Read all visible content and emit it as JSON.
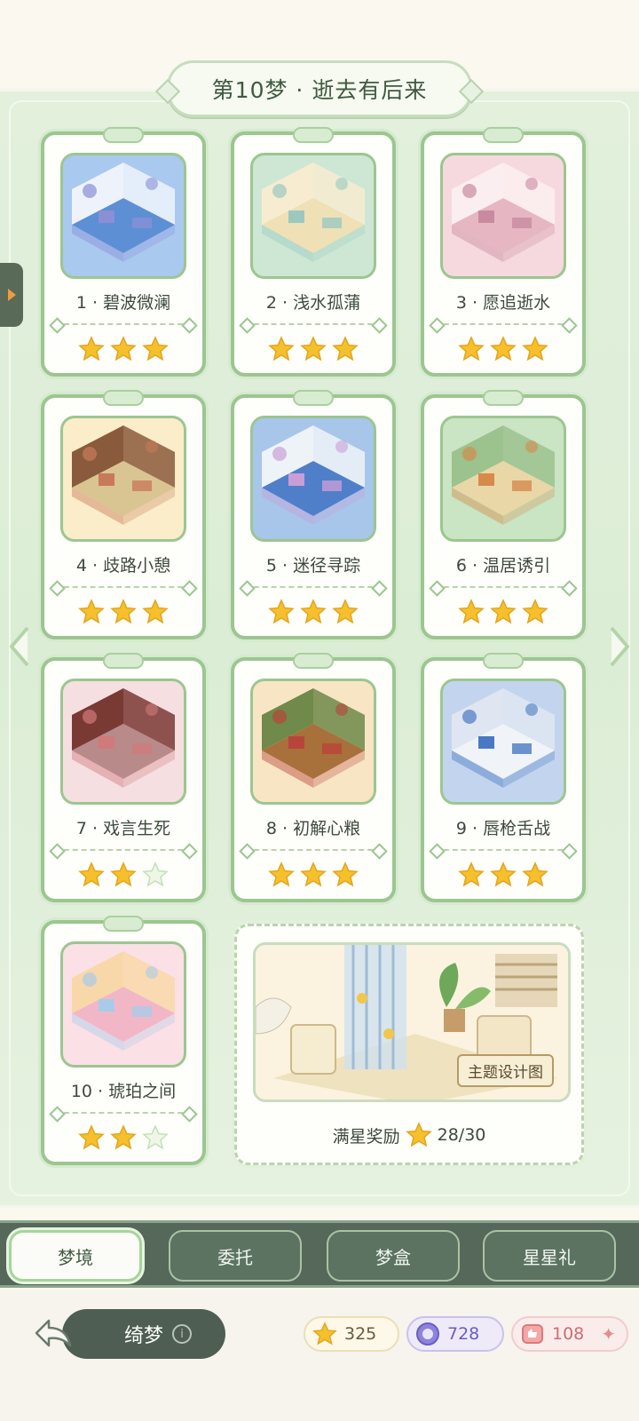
{
  "chapter_title": "第10梦 · 逝去有后来",
  "levels": [
    {
      "label": "1 · 碧波微澜",
      "stars": 3,
      "palette": {
        "bg": "#a9c9ef",
        "floor": "#5d8fd4",
        "wall": "#eef3fb",
        "accent": "#8a8fd6"
      }
    },
    {
      "label": "2 · 浅水孤蒲",
      "stars": 3,
      "palette": {
        "bg": "#cde7d4",
        "floor": "#efe1b5",
        "wall": "#f7ecd0",
        "accent": "#9bc9c0"
      }
    },
    {
      "label": "3 · 愿追逝水",
      "stars": 3,
      "palette": {
        "bg": "#f6d9de",
        "floor": "#e6b7c2",
        "wall": "#fbeef0",
        "accent": "#c98aa0"
      }
    },
    {
      "label": "4 · 歧路小憩",
      "stars": 3,
      "palette": {
        "bg": "#fbedc9",
        "floor": "#d9c592",
        "wall": "#8a5a3c",
        "accent": "#c77a5a"
      }
    },
    {
      "label": "5 · 迷径寻踪",
      "stars": 3,
      "palette": {
        "bg": "#a7c6ea",
        "floor": "#4f7fc9",
        "wall": "#eef3f8",
        "accent": "#c99ed6"
      }
    },
    {
      "label": "6 · 温居诱引",
      "stars": 3,
      "palette": {
        "bg": "#c9e5c3",
        "floor": "#e9d7a7",
        "wall": "#9cc28e",
        "accent": "#d68a4c"
      }
    },
    {
      "label": "7 · 戏言生死",
      "stars": 2,
      "palette": {
        "bg": "#f6dfe0",
        "floor": "#b98a8a",
        "wall": "#7a3a34",
        "accent": "#d07a7a"
      }
    },
    {
      "label": "8 · 初解心粮",
      "stars": 3,
      "palette": {
        "bg": "#f8e5c4",
        "floor": "#a8703a",
        "wall": "#6f8a4a",
        "accent": "#b8453a"
      }
    },
    {
      "label": "9 · 唇枪舌战",
      "stars": 3,
      "palette": {
        "bg": "#c3d5ee",
        "floor": "#f0f3f8",
        "wall": "#dfe6f1",
        "accent": "#4a79c4"
      }
    },
    {
      "label": "10 · 琥珀之间",
      "stars": 2,
      "palette": {
        "bg": "#fbe0e6",
        "floor": "#f2b7c6",
        "wall": "#f8d8a8",
        "accent": "#a9cbea"
      }
    }
  ],
  "reward": {
    "tag": "主题设计图",
    "label": "满星奖励",
    "progress": "28/30"
  },
  "tabs": [
    {
      "label": "梦境",
      "active": true
    },
    {
      "label": "委托",
      "active": false
    },
    {
      "label": "梦盒",
      "active": false
    },
    {
      "label": "星星礼",
      "active": false
    }
  ],
  "footer": {
    "dream_label": "绮梦",
    "info_icon": "i",
    "currencies": {
      "stars": "325",
      "gems": "728",
      "likes": "108"
    }
  },
  "colors": {
    "star_filled": "#f5c02c",
    "star_empty": "#eef7e6",
    "accent_green": "#9cc690"
  }
}
